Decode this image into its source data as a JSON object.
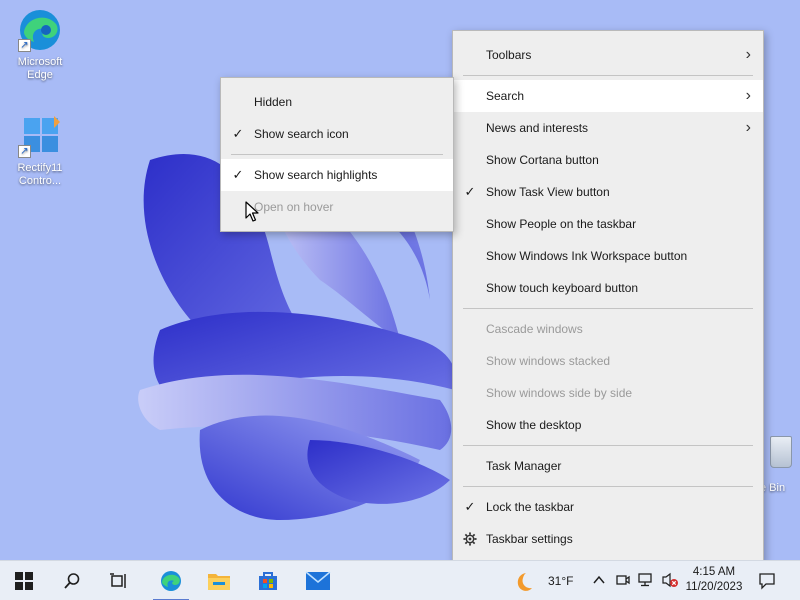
{
  "desktop": {
    "icons": [
      {
        "label_line1": "Microsoft",
        "label_line2": "Edge"
      },
      {
        "label_line1": "Rectify11",
        "label_line2": "Contro..."
      }
    ],
    "recycle_label": "e Bin"
  },
  "main_menu": {
    "items": [
      {
        "label": "Toolbars",
        "submenu": true
      },
      {
        "label": "Search",
        "submenu": true,
        "highlighted": true
      },
      {
        "label": "News and interests",
        "submenu": true
      },
      {
        "label": "Show Cortana button"
      },
      {
        "label": "Show Task View button",
        "checked": true
      },
      {
        "label": "Show People on the taskbar"
      },
      {
        "label": "Show Windows Ink Workspace button"
      },
      {
        "label": "Show touch keyboard button"
      },
      {
        "label": "Cascade windows",
        "disabled": true
      },
      {
        "label": "Show windows stacked",
        "disabled": true
      },
      {
        "label": "Show windows side by side",
        "disabled": true
      },
      {
        "label": "Show the desktop"
      },
      {
        "label": "Task Manager"
      },
      {
        "label": "Lock the taskbar",
        "checked": true
      },
      {
        "label": "Taskbar settings",
        "icon": "gear-icon"
      }
    ]
  },
  "search_submenu": {
    "items": [
      {
        "label": "Hidden"
      },
      {
        "label": "Show search icon",
        "checked": true
      },
      {
        "label": "Show search highlights",
        "checked": true,
        "highlighted": true
      },
      {
        "label": "Open on hover",
        "disabled": true
      }
    ]
  },
  "glyphs": {
    "check": "✓",
    "arrow": "›"
  },
  "taskbar": {
    "buttons": [
      "start-icon",
      "search-icon",
      "task-view-icon",
      "edge-icon",
      "file-explorer-icon",
      "microsoft-store-icon",
      "mail-icon"
    ],
    "weather": {
      "temperature": "31°F",
      "icon": "weather-moon-icon"
    },
    "tray_icons": [
      "chevron-up-icon",
      "meet-now-icon",
      "network-icon",
      "volume-muted-icon"
    ],
    "time": "4:15 AM",
    "date": "11/20/2023",
    "notification_icon": "notification-icon"
  },
  "colors": {
    "desktop_bg": "#a8bbf6",
    "menu_bg": "#eeeeee",
    "menu_highlight": "#ffffff",
    "accent": "#5a7bd0"
  }
}
